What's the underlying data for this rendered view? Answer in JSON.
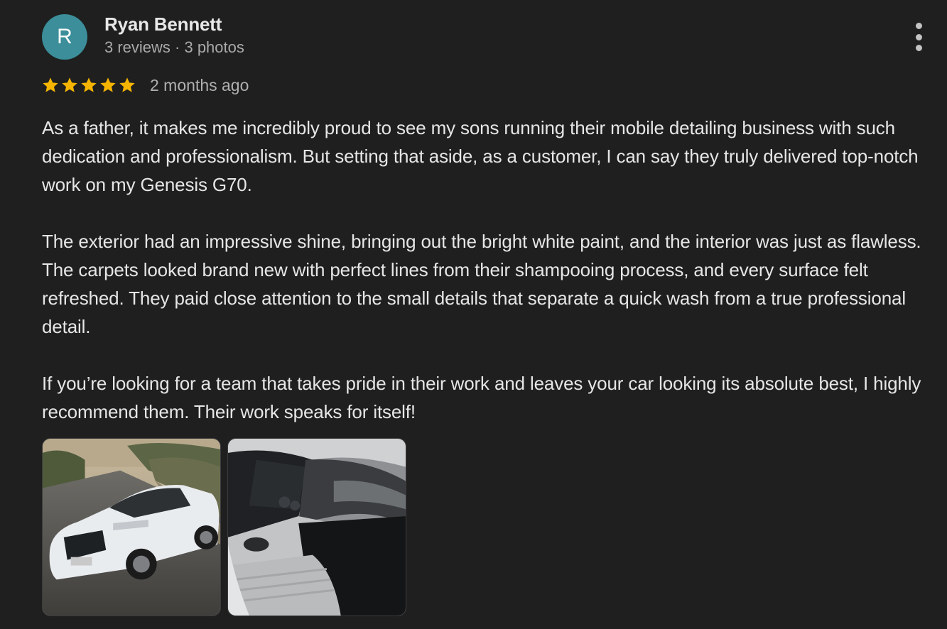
{
  "reviewer": {
    "avatar_letter": "R",
    "avatar_color": "#3b8e9a",
    "name": "Ryan Bennett",
    "meta": "3 reviews · 3 photos"
  },
  "rating": {
    "stars": 5,
    "max": 5,
    "star_color": "#f4b400",
    "time_ago": "2 months ago"
  },
  "review": {
    "paragraphs": [
      "As a father, it makes me incredibly proud to see my sons running their mobile detailing business with such dedication and professionalism. But setting that aside, as a customer, I can say they truly delivered top-notch work on my Genesis G70.",
      "The exterior had an impressive shine, bringing out the bright white paint, and the interior was just as flawless. The carpets looked brand new with perfect lines from their shampooing process, and every surface felt refreshed. They paid close attention to the small details that separate a quick wash from a true professional detail.",
      "If you’re looking for a team that takes pride in their work and leaves your car looking its absolute best, I highly recommend them. Their work speaks for itself!"
    ]
  },
  "photos": [
    {
      "subject": "white-sedan-exterior"
    },
    {
      "subject": "car-interior-carpets-seats"
    }
  ],
  "menu": {
    "icon": "more-vert-icon"
  }
}
